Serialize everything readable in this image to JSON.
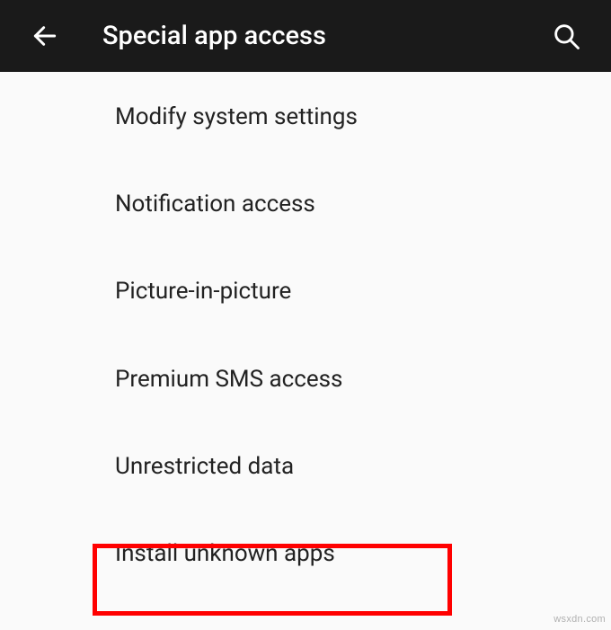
{
  "header": {
    "title": "Special app access"
  },
  "items": [
    {
      "label": "Modify system settings"
    },
    {
      "label": "Notification access"
    },
    {
      "label": "Picture-in-picture"
    },
    {
      "label": "Premium SMS access"
    },
    {
      "label": "Unrestricted data"
    },
    {
      "label": "Install unknown apps"
    }
  ],
  "watermark": "wsxdn.com"
}
